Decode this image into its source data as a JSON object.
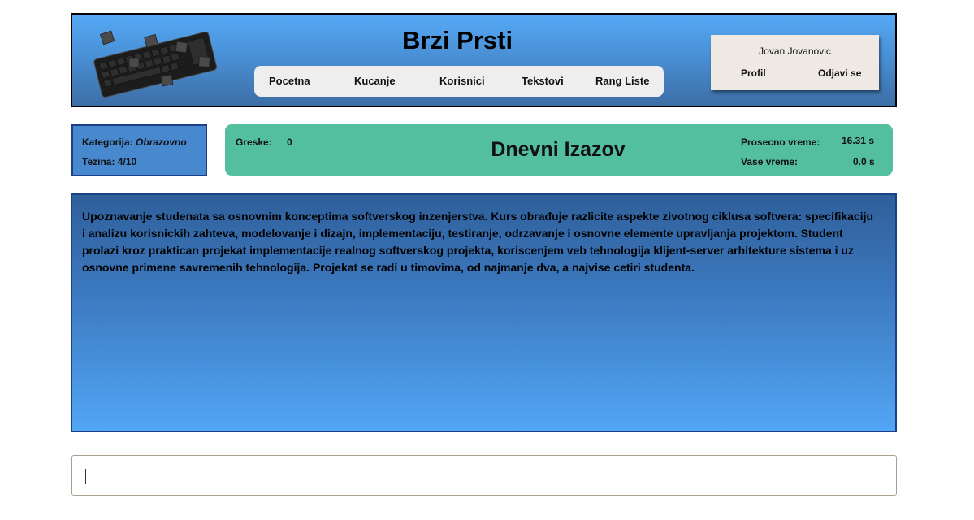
{
  "header": {
    "title": "Brzi Prsti",
    "logo_icon": "keyboard-icon",
    "nav": [
      {
        "label": "Pocetna"
      },
      {
        "label": "Kucanje"
      },
      {
        "label": "Korisnici"
      },
      {
        "label": "Tekstovi"
      },
      {
        "label": "Rang Liste"
      }
    ],
    "user": {
      "name": "Jovan Jovanovic",
      "profile_label": "Profil",
      "logout_label": "Odjavi se"
    }
  },
  "info": {
    "category_label": "Kategorija:",
    "category_value": "Obrazovno",
    "difficulty_label": "Tezina:",
    "difficulty_value": "4/10"
  },
  "stats": {
    "errors_label": "Greske:",
    "errors_value": "0",
    "challenge_title": "Dnevni Izazov",
    "avg_time_label": "Prosecno vreme:",
    "avg_time_value": "16.31 s",
    "your_time_label": "Vase vreme:",
    "your_time_value": "0.0 s"
  },
  "text": {
    "content": "Upoznavanje studenata sa osnovnim konceptima softverskog inzenjerstva. Kurs obrađuje razlicite aspekte zivotnog ciklusa softvera: specifikaciju i analizu korisnickih zahteva, modelovanje i dizajn, implementaciju, testiranje, odrzavanje i osnovne elemente upravljanja projektom. Student prolazi kroz praktican projekat implementacije realnog softverskog projekta, koriscenjem veb tehnologija klijent-server arhitekture sistema i uz osnovne primene savremenih tehnologija. Projekat se radi u timovima, od najmanje dva, a najvise cetiri studenta."
  },
  "input": {
    "value": "",
    "placeholder": ""
  },
  "colors": {
    "header_top": "#55a9f5",
    "header_bottom": "#3c6ea6",
    "stats_bg": "#53bf9e",
    "category_bg": "#4788cf",
    "border_dark": "#1c3f86"
  }
}
